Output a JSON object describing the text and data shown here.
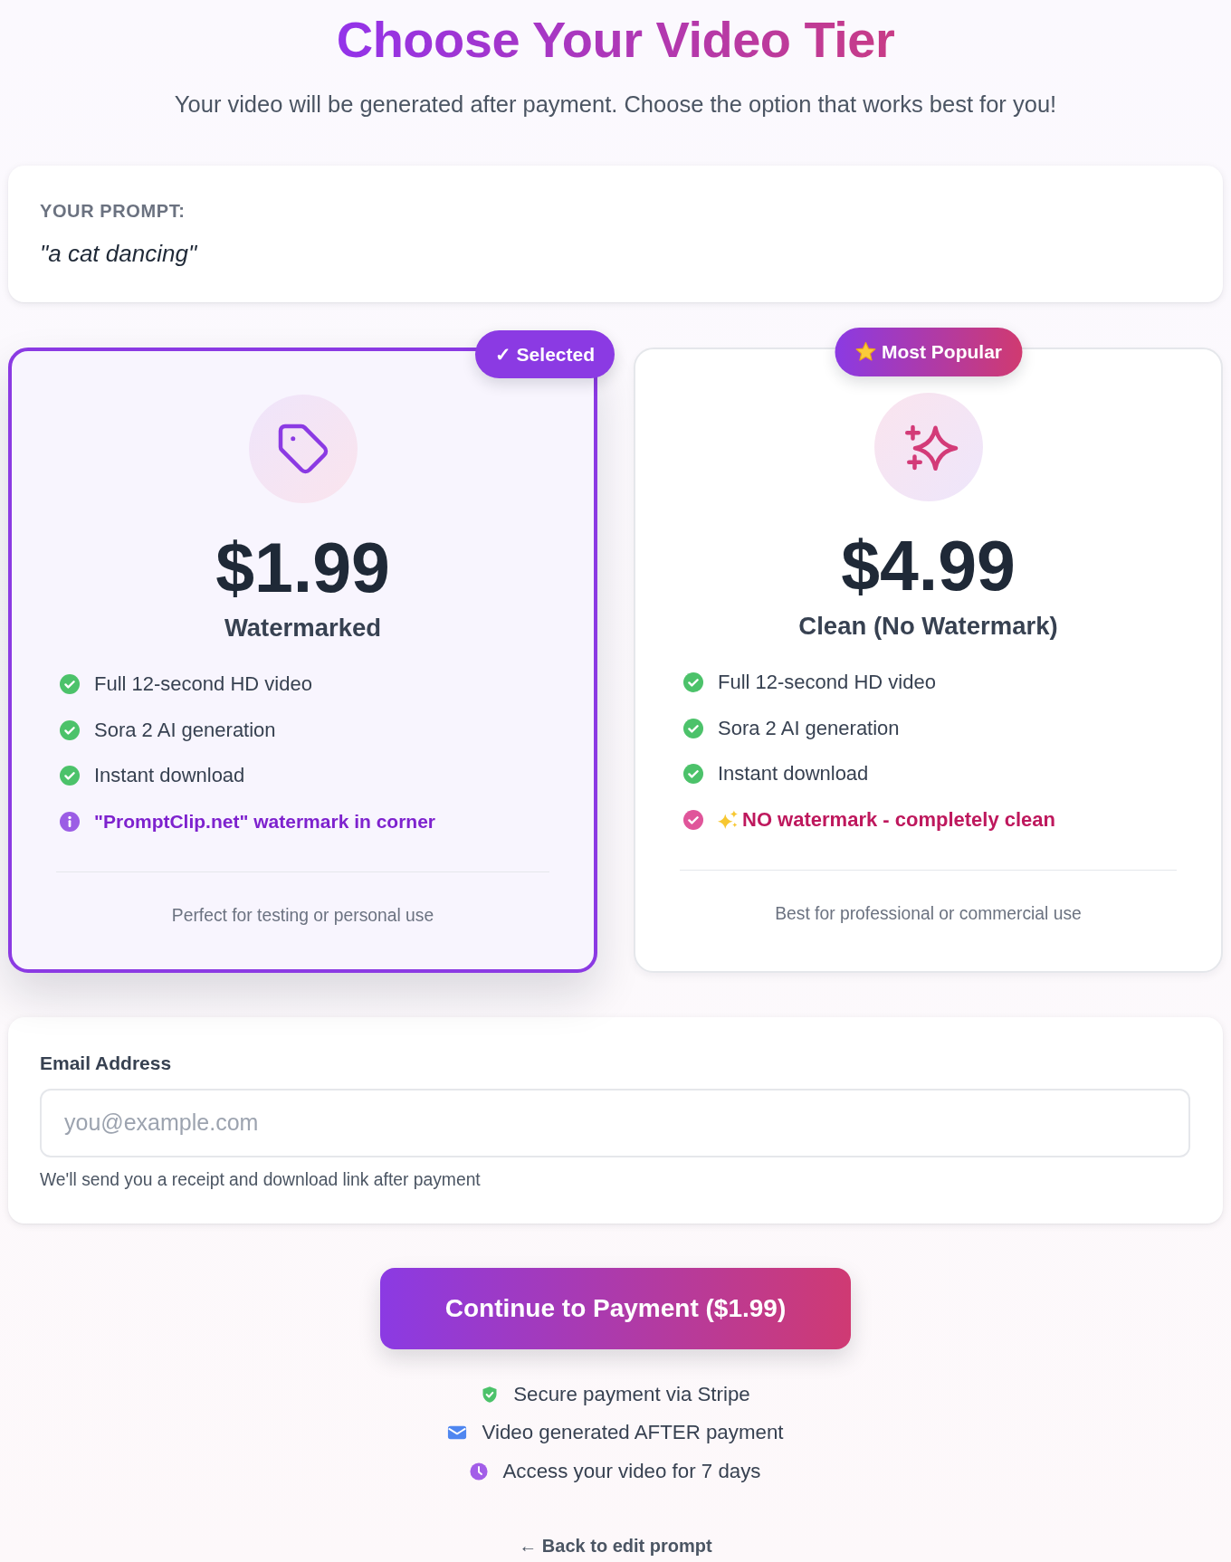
{
  "header": {
    "title": "Choose Your Video Tier",
    "subtitle": "Your video will be generated after payment. Choose the option that works best for you!"
  },
  "prompt": {
    "label": "YOUR PROMPT:",
    "text": "\"a cat dancing\""
  },
  "selected_badge": "✓ Selected",
  "tiers": [
    {
      "selected": true,
      "price": "$1.99",
      "name": "Watermarked",
      "features": [
        {
          "kind": "included",
          "text": "Full 12-second HD video"
        },
        {
          "kind": "included",
          "text": "Sora 2 AI generation"
        },
        {
          "kind": "included",
          "text": "Instant download"
        },
        {
          "kind": "info",
          "text": "\"PromptClip.net\" watermark in corner"
        }
      ],
      "note": "Perfect for testing or personal use"
    },
    {
      "selected": false,
      "badge": "Most Popular",
      "price": "$4.99",
      "name": "Clean (No Watermark)",
      "features": [
        {
          "kind": "included",
          "text": "Full 12-second HD video"
        },
        {
          "kind": "included",
          "text": "Sora 2 AI generation"
        },
        {
          "kind": "included",
          "text": "Instant download"
        },
        {
          "kind": "highlight",
          "text": "NO watermark - completely clean"
        }
      ],
      "note": "Best for professional or commercial use"
    }
  ],
  "email": {
    "label": "Email Address",
    "placeholder": "you@example.com",
    "help": "We'll send you a receipt and download link after payment"
  },
  "submit_button": "Continue to Payment ($1.99)",
  "assurances": [
    "Secure payment via Stripe",
    "Video generated AFTER payment",
    "Access your video for 7 days"
  ],
  "back_link": "← Back to edit prompt"
}
